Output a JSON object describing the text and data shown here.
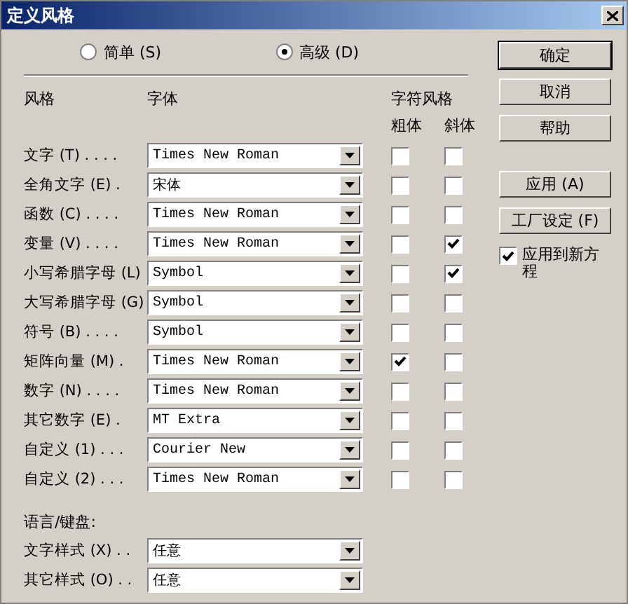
{
  "window": {
    "title": "定义风格"
  },
  "modes": [
    {
      "label": "简单 (S)",
      "selected": false
    },
    {
      "label": "高级 (D)",
      "selected": true
    }
  ],
  "headers": {
    "style": "风格",
    "font": "字体",
    "char_style": "字符风格",
    "bold": "粗体",
    "italic": "斜体"
  },
  "styles": [
    {
      "label": "文字 (T) . . . .",
      "font": "Times New Roman",
      "bold": false,
      "italic": false
    },
    {
      "label": "全角文字 (E) .",
      "font": "宋体",
      "bold": false,
      "italic": false
    },
    {
      "label": "函数 (C) . . . .",
      "font": "Times New Roman",
      "bold": false,
      "italic": false
    },
    {
      "label": "变量 (V) . . . .",
      "font": "Times New Roman",
      "bold": false,
      "italic": true
    },
    {
      "label": "小写希腊字母 (L)",
      "font": "Symbol",
      "bold": false,
      "italic": true
    },
    {
      "label": "大写希腊字母 (G)",
      "font": "Symbol",
      "bold": false,
      "italic": false
    },
    {
      "label": "符号 (B) . . . .",
      "font": "Symbol",
      "bold": false,
      "italic": false
    },
    {
      "label": "矩阵向量 (M) .",
      "font": "Times New Roman",
      "bold": true,
      "italic": false
    },
    {
      "label": "数字 (N) . . . .",
      "font": "Times New Roman",
      "bold": false,
      "italic": false
    },
    {
      "label": "其它数字 (E) .",
      "font": "MT Extra",
      "bold": false,
      "italic": false
    },
    {
      "label": "自定义 (1) . . .",
      "font": "Courier New",
      "bold": false,
      "italic": false
    },
    {
      "label": "自定义 (2) . . .",
      "font": "Times New Roman",
      "bold": false,
      "italic": false
    }
  ],
  "language_keyboard": {
    "title": "语言/键盘:",
    "rows": [
      {
        "label": "文字样式 (X) . .",
        "value": "任意"
      },
      {
        "label": "其它样式 (O) . .",
        "value": "任意"
      }
    ]
  },
  "buttons": [
    {
      "label": "确定",
      "default": true
    },
    {
      "label": "取消",
      "default": false
    },
    {
      "label": "帮助",
      "default": false
    },
    {
      "label": "应用 (A)",
      "default": false
    },
    {
      "label": "工厂设定 (F)",
      "default": false
    }
  ],
  "apply_new": {
    "label": "应用到新方程",
    "checked": true
  }
}
